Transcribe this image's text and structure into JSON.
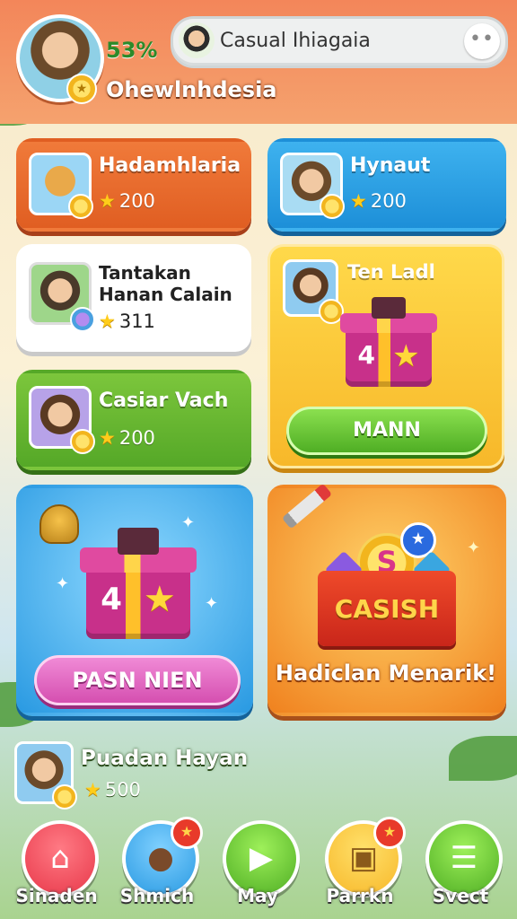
{
  "header": {
    "percent": "53%",
    "username": "Ohewlnhdesia",
    "pill_title": "Casual Ihiagaia",
    "more_icon": "more-dots-icon"
  },
  "cards": [
    {
      "title": "Hadamhlaria",
      "score": "200"
    },
    {
      "title": "Hynaut",
      "score": "200"
    },
    {
      "title": "Tantakan Hanan Calain",
      "score": "311"
    },
    {
      "title": "Ten Ladl",
      "button": "MANN"
    },
    {
      "title": "Casiar Vach",
      "score": "200"
    },
    {
      "button": "PASN NIEN"
    },
    {
      "box_label": "CASISH",
      "coin_letter": "S",
      "caption": "Hadiclan Menarik!"
    }
  ],
  "bottom_player": {
    "name": "Puadan Hayan",
    "score": "500"
  },
  "nav": [
    {
      "label": "Sinaden",
      "icon": "home-icon",
      "color": "#e8384a"
    },
    {
      "label": "Shmich",
      "icon": "character-icon",
      "color": "#2a9ae2"
    },
    {
      "label": "May",
      "icon": "play-icon",
      "color": "#4fae24"
    },
    {
      "label": "Parrkn",
      "icon": "puzzle-icon",
      "color": "#f7b82a"
    },
    {
      "label": "Svect",
      "icon": "list-icon",
      "color": "#4fae24"
    }
  ]
}
